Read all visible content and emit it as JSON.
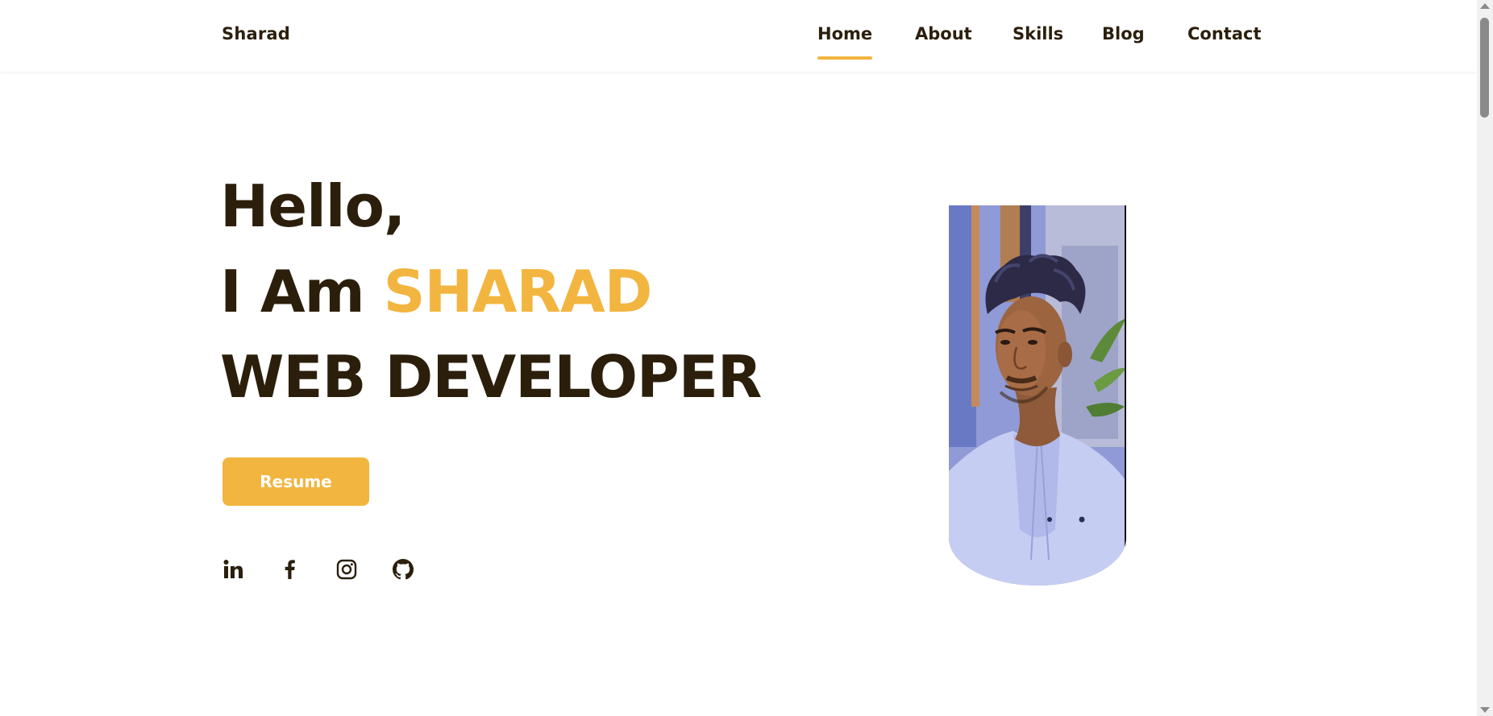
{
  "header": {
    "brand": "Sharad",
    "nav": [
      {
        "label": "Home",
        "active": true
      },
      {
        "label": "About",
        "active": false
      },
      {
        "label": "Skills",
        "active": false
      },
      {
        "label": "Blog",
        "active": false
      },
      {
        "label": "Contact",
        "active": false
      }
    ]
  },
  "hero": {
    "greeting": "Hello,",
    "intro_prefix": "I Am ",
    "name": "SHARAD",
    "role": "WEB DEVELOPER",
    "resume_label": "Resume"
  },
  "social": [
    {
      "icon": "linkedin-icon"
    },
    {
      "icon": "facebook-icon"
    },
    {
      "icon": "instagram-icon"
    },
    {
      "icon": "github-icon"
    }
  ],
  "colors": {
    "accent": "#f2b53f",
    "text": "#2b1f0c",
    "background": "#ffffff"
  }
}
